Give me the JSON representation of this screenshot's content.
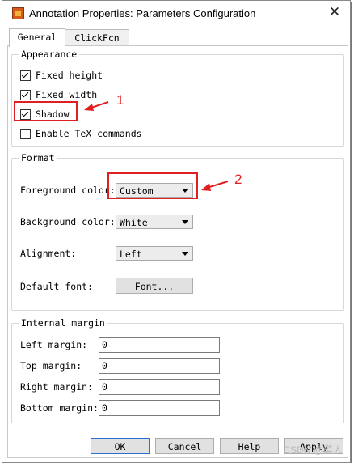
{
  "window": {
    "title": "Annotation Properties: Parameters Configuration",
    "close_glyph": "✕"
  },
  "tabs": [
    {
      "label": "General",
      "active": true
    },
    {
      "label": "ClickFcn",
      "active": false
    }
  ],
  "appearance": {
    "group_title": "Appearance",
    "checkboxes": [
      {
        "label": "Fixed height",
        "checked": true
      },
      {
        "label": "Fixed width",
        "checked": true
      },
      {
        "label": "Shadow",
        "checked": true
      },
      {
        "label": "Enable TeX commands",
        "checked": false
      }
    ]
  },
  "format": {
    "group_title": "Format",
    "foreground_label": "Foreground color:",
    "foreground_value": "Custom",
    "background_label": "Background color:",
    "background_value": "White",
    "alignment_label": "Alignment:",
    "alignment_value": "Left",
    "font_label": "Default font:",
    "font_button": "Font..."
  },
  "margin": {
    "group_title": "Internal margin",
    "fields": [
      {
        "label": "Left margin:",
        "value": "0"
      },
      {
        "label": "Top margin:",
        "value": "0"
      },
      {
        "label": "Right margin:",
        "value": "0"
      },
      {
        "label": "Bottom margin:",
        "value": "0"
      }
    ]
  },
  "buttons": {
    "ok": "OK",
    "cancel": "Cancel",
    "help": "Help",
    "apply": "Apply"
  },
  "annotations": {
    "marker_1": "1",
    "marker_2": "2",
    "color": "#e02020"
  },
  "watermark": "CSDN @菜人"
}
